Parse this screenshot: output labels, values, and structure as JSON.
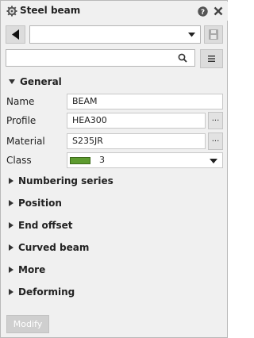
{
  "window": {
    "title": "Steel beam",
    "icons": {
      "title": "gear-icon",
      "help": "help-icon",
      "close": "close-icon"
    }
  },
  "toolbar": {
    "preset_value": "",
    "search_placeholder": "",
    "icons": {
      "back": "back-arrow-icon",
      "save": "save-icon",
      "search": "search-icon",
      "menu": "menu-icon"
    }
  },
  "general": {
    "header": "General",
    "fields": {
      "name": {
        "label": "Name",
        "value": "BEAM"
      },
      "profile": {
        "label": "Profile",
        "value": "HEA300",
        "button": "..."
      },
      "material": {
        "label": "Material",
        "value": "S235JR",
        "button": "..."
      },
      "class": {
        "label": "Class",
        "value": "3",
        "color": "#5d9b2f"
      }
    }
  },
  "sections": [
    "Numbering series",
    "Position",
    "End offset",
    "Curved beam",
    "More",
    "Deforming"
  ],
  "footer": {
    "modify_label": "Modify"
  }
}
